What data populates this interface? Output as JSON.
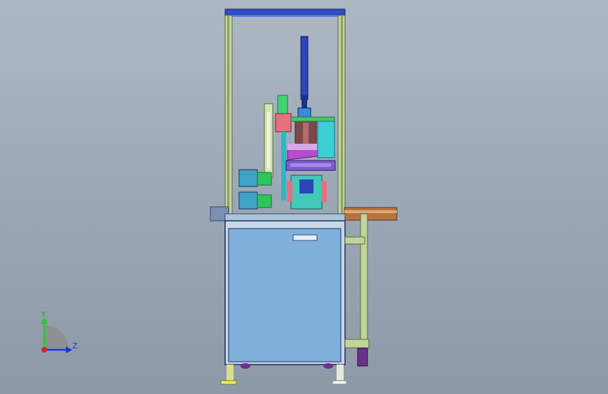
{
  "viewport": {
    "colors": {
      "frame": "#c4d49a",
      "frame_dark": "#556b3e",
      "top_beam": "#2d4fc7",
      "cabinet_panel": "#7fb0dc",
      "cabinet_edge": "#1d2d5a",
      "cylinder": "#2a46b8",
      "pink_block": "#e86f80",
      "magenta_plate": "#b54bd1",
      "green_part": "#37d86a",
      "teal_part": "#2fb7c0",
      "motor": "#3fa2c6",
      "brown_bar": "#b5733f",
      "yellow_foot": "#f2ec62",
      "purple_caster": "#6b2f8e"
    }
  },
  "triad": {
    "y_label": "Y",
    "z_label": "Z",
    "y_color": "#22cc22",
    "z_color": "#1b35d8",
    "x_color": "#e02020",
    "icon": "axis-triad-icon"
  }
}
